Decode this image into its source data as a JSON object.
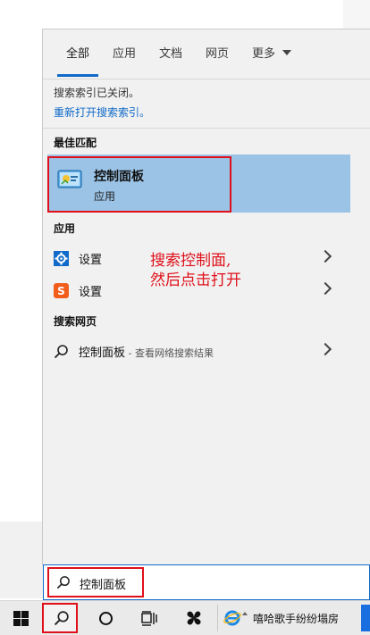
{
  "tabs": [
    {
      "label": "全部",
      "active": true
    },
    {
      "label": "应用",
      "active": false
    },
    {
      "label": "文档",
      "active": false
    },
    {
      "label": "网页",
      "active": false
    },
    {
      "label": "更多",
      "active": false
    }
  ],
  "notice": {
    "text": "搜索索引已关闭。",
    "link": "重新打开搜索索引。"
  },
  "best_match": {
    "section": "最佳匹配",
    "title": "控制面板",
    "subtitle": "应用",
    "icon": "control-panel-icon"
  },
  "apps": {
    "section": "应用",
    "items": [
      {
        "label": "设置",
        "icon": "gear-icon"
      },
      {
        "label": "设置",
        "icon": "sogou-s-icon"
      }
    ]
  },
  "web": {
    "section": "搜索网页",
    "query": "控制面板",
    "suffix": " - 查看网络搜索结果"
  },
  "annotation": {
    "line1": "搜索控制面,",
    "line2": "然后点击打开"
  },
  "search": {
    "value": "控制面板"
  },
  "taskbar": {
    "app_title": "嘻哈歌手纷纷塌房"
  },
  "colors": {
    "accent": "#0f6ac9",
    "highlight": "#9bc3e6",
    "annotation_red": "#e0101a"
  }
}
